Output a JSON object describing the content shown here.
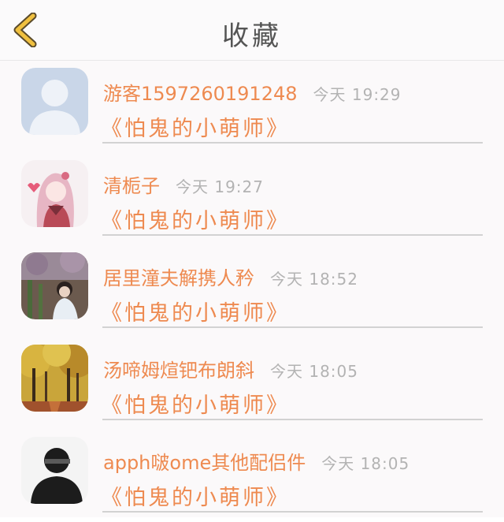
{
  "header": {
    "title": "收藏"
  },
  "items": [
    {
      "name": "游客1597260191248",
      "time": "今天 19:29",
      "work": "《怕鬼的小萌师》",
      "avatar": "default-avatar"
    },
    {
      "name": "清栀子",
      "time": "今天 19:27",
      "work": "《怕鬼的小萌师》",
      "avatar": "anime-girl-avatar"
    },
    {
      "name": "居里潼夫解携人矜",
      "time": "今天 18:52",
      "work": "《怕鬼的小萌师》",
      "avatar": "girl-garden-avatar"
    },
    {
      "name": "汤啼姆煊钯布朗斜",
      "time": "今天 18:05",
      "work": "《怕鬼的小萌师》",
      "avatar": "autumn-forest-avatar"
    },
    {
      "name": "apph啵ome其他配侣件",
      "time": "今天 18:05",
      "work": "《怕鬼的小萌师》",
      "avatar": "dark-figure-avatar"
    }
  ],
  "colors": {
    "accent": "#ee8a50",
    "muted": "#b3b3b3",
    "back_arrow": "#f0c040"
  }
}
